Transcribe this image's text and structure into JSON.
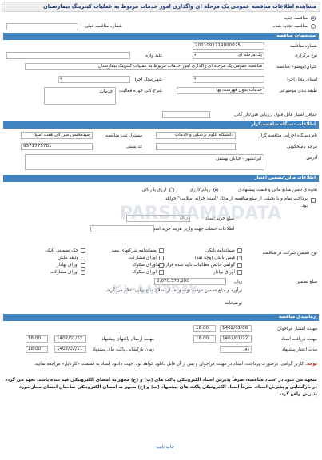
{
  "title": "مشاهده اطلاعات مناقصه عمومی یک مرحله ای واگذاری امور خدمات مربوط به عملیات کیترینگ بیمارستان",
  "tender_type": {
    "new_label": "مناقصه جدید",
    "renewed_label": "مناقصه تجدید شده",
    "previous_number_label": "شماره مناقصه قبلی"
  },
  "section_info": "مشخصات مناقصه",
  "info": {
    "number_label": "شماره مناقصه",
    "number_value": "2001091219000025",
    "holding_type_label": "نوع برگزاری",
    "holding_type_value": "یک مرحله ای",
    "key_label": "کلید واژه",
    "subject_label": "عنوان/موضوع مناقصه",
    "subject_value": "مناقصه عمومی یک مرحله ای واگذاری امور خدمات مربوط به عملیات کیترینگ بیمارستان",
    "province_label": "استان محل اجرا",
    "city_label": "شهر محل اجرا",
    "category_label": "طبقه بندی موضوعی",
    "category_value": "خدمات بدون فهرست بها",
    "activity_label": "شرح کلی حوزه فعالیت",
    "activity_value": "خدمات",
    "min_score_label": "حداقل امتیاز قابل قبول ارزیابی فنی/بازرگانی"
  },
  "section_org": "اطلاعات دستگاه مناقصه گزار",
  "org": {
    "name_label": "نام دستگاه اجرایی مناقصه گزار",
    "name_value": "دانشگاه علوم پزشکی و خدمات",
    "registrar_label": "مسئول ثبت مناقصه",
    "registrar_value": "سیدمحسن میرزائی هفت آسیا",
    "reference_label": "مرجع پاسخگویی",
    "postal_label": "کد پستی",
    "postal_value": "9371775781",
    "address_label": "آدرس",
    "address_value": "ایرانشهر - خیابان بهشتی"
  },
  "section_finance": "اطلاعات مالی/تضمین اعتبار",
  "finance": {
    "source_label": "نحوه ی تأمین منابع مالی و قیمت پیشنهادی",
    "rial_label": "ریالی/ارزی",
    "rial_or_currency_label": "ارزی یا ریالی",
    "payment_note": "پرداخت تمام و یا بخشی از مبلغ مناقصه از محل \"اسناد خزانه اسلامی\" خواهد بود.",
    "doc_price_label": "مبلغ خرید اسناد",
    "doc_price_value": "ریال",
    "account_label": "اطلاعات حساب جهت واریز هزینه خرید اسناد"
  },
  "guarantee": {
    "type_label": "نوع تضمین شرکت در مناقصه",
    "options": [
      {
        "label": "ضمانتنامه بانکی",
        "checked": false
      },
      {
        "label": "ضمانتنامه شرکتهای بیمه",
        "checked": false
      },
      {
        "label": "چک تضمینی بانکی",
        "checked": false
      },
      {
        "label": "فیش بانکی (وجه نقد)",
        "checked": true
      },
      {
        "label": "اوراق مشارکت",
        "checked": false
      },
      {
        "label": "وثیقه ملکی",
        "checked": false
      },
      {
        "label": "گواهی خالص مطالبات تایید شده قراردادها",
        "checked": false
      },
      {
        "label": "اوراق صکوک",
        "checked": false
      },
      {
        "label": "اوراق بهادار",
        "checked": false
      },
      {
        "label": "اوراق بهادار",
        "checked": false
      },
      {
        "label": "اوراق صکوک",
        "checked": false
      },
      {
        "label": "اوراق مشارکت",
        "checked": false
      }
    ],
    "amount_label": "مبلغ تضمین",
    "amount_value": "2,670,370,200",
    "amount_unit": "ریال",
    "note": "برآورد و مبلغ تضمین موقت بوده و بعد از اصلاح مبلغ نهایی اعلام می گردد.",
    "desc_label": "توضیحات"
  },
  "section_dates": "زمانبندی مناقصه",
  "dates": {
    "publish_label": "مهلت انتشار فراخوان",
    "publish_date": "1402/01/08",
    "publish_time": "18:00",
    "doc_deadline_label": "مهلت دریافت اسناد",
    "doc_deadline_date": "1402/01/22",
    "doc_deadline_time": "18:00",
    "submit_label": "مهلت ارسال پاکتهای پیشنهاد",
    "submit_date": "1402/01/22",
    "submit_time": "18:00",
    "open_label": "زمان بازگشایی پاکت های پیشنهاد",
    "open_date": "1402/02/11",
    "open_time": "18:00",
    "validity_label": "مدت اعتبار پیشنهاد",
    "validity_value": "روز"
  },
  "notes": {
    "n1_label": "توجه:",
    "n1": "کاربر گرامی، درصورت پرداخت، اسناد در مهلت فراخوان و پس از آن قابل دانلود خواهد بود. جهت دانلود اسناد به قسمت «کارتابل» مراجعه نمایید.",
    "n2": "متعهد می شود در اسناد مناقصه، صرفاً پذیرش اسناد الکترونیکی پاکت های (ب) و (ج) مجهز به امضای الکترونیکی قید شده باشد. تعهد می گردد در بازگشایی و پذیرش اسناد، صرفاً اسناد الکترونیکی پاکت های پیشنهاد (ب) و (ج) مجهز به امضای الکترونیکی صاحبان امضای مجاز مورد پذیرش واقع گردد."
  },
  "footer": "چاپ تایپ"
}
